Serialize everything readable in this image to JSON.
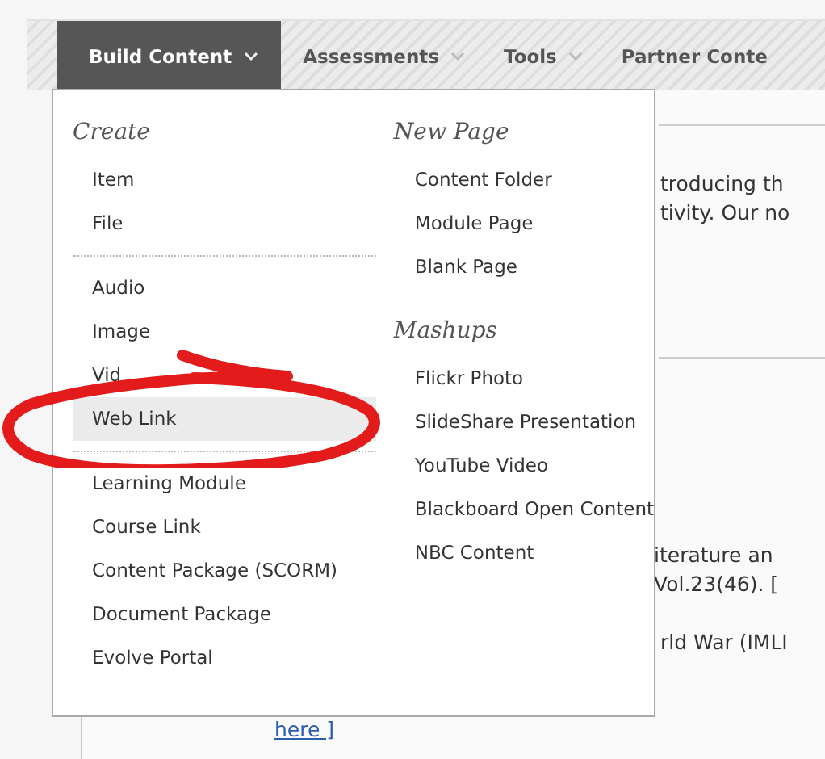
{
  "nav_tabs": [
    {
      "label": "Build Content",
      "selected": true
    },
    {
      "label": "Assessments",
      "selected": false
    },
    {
      "label": "Tools",
      "selected": false
    },
    {
      "label": "Partner Conte",
      "selected": false
    }
  ],
  "menu": {
    "columns": [
      {
        "sections": [
          {
            "heading": "Create",
            "items": [
              {
                "label": "Item",
                "selected": false
              },
              {
                "label": "File",
                "selected": false
              }
            ]
          },
          {
            "items": [
              {
                "label": "Audio",
                "selected": false
              },
              {
                "label": "Image",
                "selected": false
              },
              {
                "label": "Vid",
                "selected": false
              },
              {
                "label": "Web Link",
                "selected": true
              }
            ]
          },
          {
            "items": [
              {
                "label": "Learning Module",
                "selected": false
              },
              {
                "label": "Course Link",
                "selected": false
              },
              {
                "label": "Content Package (SCORM)",
                "selected": false
              },
              {
                "label": "Document Package",
                "selected": false
              },
              {
                "label": "Evolve Portal",
                "selected": false
              }
            ]
          }
        ]
      },
      {
        "sections": [
          {
            "heading": "New Page",
            "items": [
              {
                "label": "Content Folder",
                "selected": false
              },
              {
                "label": "Module Page",
                "selected": false
              },
              {
                "label": "Blank Page",
                "selected": false
              }
            ]
          },
          {
            "heading": "Mashups",
            "items": [
              {
                "label": "Flickr Photo",
                "selected": false
              },
              {
                "label": "SlideShare Presentation",
                "selected": false
              },
              {
                "label": "YouTube Video",
                "selected": false
              },
              {
                "label": "Blackboard Open Content",
                "selected": false
              },
              {
                "label": "NBC Content",
                "selected": false
              }
            ]
          }
        ]
      }
    ]
  },
  "content_fragments": [
    {
      "lines": [
        "troducing th",
        "tivity. Our no"
      ]
    },
    {
      "lines": [
        "iterature an",
        "Vol.23(46). ["
      ]
    },
    {
      "lines": [
        "rld War (IMLI"
      ]
    }
  ],
  "link_fragment": "here ]"
}
